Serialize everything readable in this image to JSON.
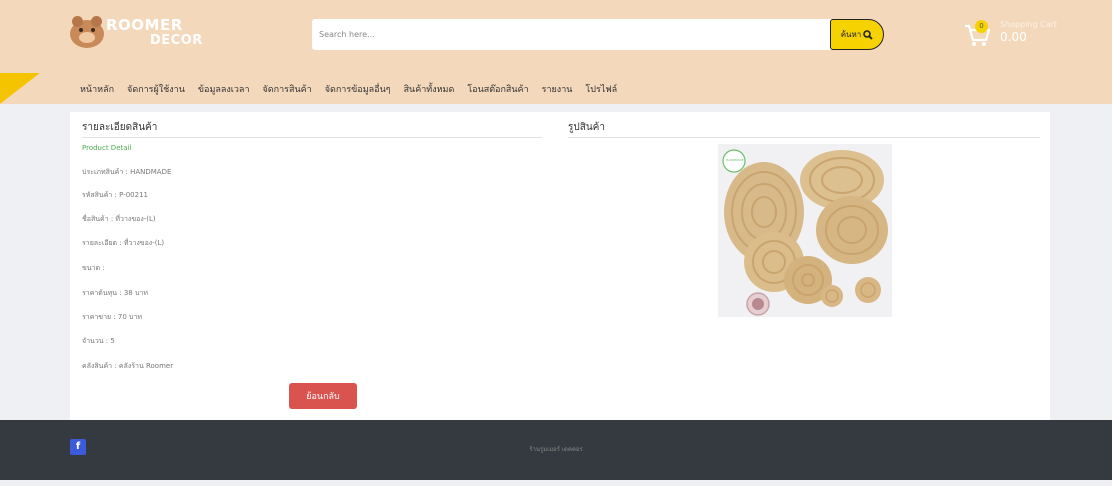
{
  "brand": {
    "line1": "ROOMER",
    "line2": "DECOR",
    "icon": "bear-logo-icon"
  },
  "search": {
    "placeholder": "Search here...",
    "button_label": "ค้นหา",
    "button_icon": "search-icon"
  },
  "cart": {
    "title": "Shopping Cart",
    "total": "0.00",
    "count": "0",
    "icon": "cart-icon"
  },
  "nav": {
    "items": [
      "หน้าหลัก",
      "จัดการผู้ใช้งาน",
      "ข้อมูลลงเวลา",
      "จัดการสินค้า",
      "จัดการข้อมูลอื่นๆ",
      "สินค้าทั้งหมด",
      "โอนสต๊อกสินค้า",
      "รายงาน",
      "โปรไฟล์"
    ]
  },
  "detail": {
    "title": "รายละเอียดสินค้า",
    "subtitle": "Product Detail",
    "fields": [
      "ประเภทสินค้า : HANDMADE",
      "รหัสสินค้า : P-00211",
      "ชื่อสินค้า : ที่วางของ-(L)",
      "รายละเอียด : ที่วางของ-(L)",
      "ขนาด :",
      "ราคาต้นทุน : 38 บาท",
      "ราคาขาย : 70 บาท",
      "จำนวน : 5",
      "คลังสินค้า : คลังร้าน Roomer"
    ],
    "back_label": "ย้อนกลับ"
  },
  "image_section": {
    "title": "รูปสินค้า",
    "badge": "HANDMADE"
  },
  "footer": {
    "copyright": "ร้านรูมเมอร์ เดคคอร",
    "facebook_icon": "facebook-icon"
  },
  "colors": {
    "header_bg": "#f3d8bc",
    "accent": "#f5d200",
    "danger": "#d9534f",
    "footer_bg": "#343a40",
    "green": "#4caf50"
  }
}
